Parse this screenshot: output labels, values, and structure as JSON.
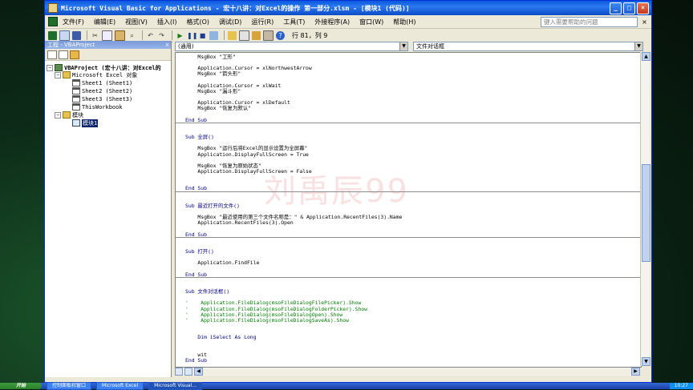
{
  "window": {
    "title": "Microsoft Visual Basic for Applications - 宏十八讲：对Excel的操作 第一部分.xlsm - [模块1 (代码)]"
  },
  "menu": {
    "items": [
      "文件(F)",
      "编辑(E)",
      "视图(V)",
      "插入(I)",
      "格式(O)",
      "调试(D)",
      "运行(R)",
      "工具(T)",
      "外接程序(A)",
      "窗口(W)",
      "帮助(H)"
    ],
    "help_placeholder": "键入需要帮助的问题"
  },
  "toolbar": {
    "row_col": "行 81，列 9"
  },
  "project": {
    "title": "工程 - VBAProject",
    "root": "VBAProject (宏十八讲：对Excel的",
    "excel_objects": "Microsoft Excel 对象",
    "sheets": [
      "Sheet1 (Sheet1)",
      "Sheet2 (Sheet2)",
      "Sheet3 (Sheet3)",
      "ThisWorkbook"
    ],
    "modules_folder": "模块",
    "module1": "模块1"
  },
  "editor": {
    "object_dropdown": "(通用)",
    "proc_dropdown": "文件对话框",
    "watermark": "刘禹辰99",
    "lines": [
      "    MsgBox \"工形\"",
      "",
      "    Application.Cursor = xlNorthwestArrow",
      "    MsgBox \"箭头形\"",
      "",
      "    Application.Cursor = xlWait",
      "    MsgBox \"漏斗形\"",
      "",
      "    Application.Cursor = xlDefault",
      "    MsgBox \"恢复为默认\"",
      "",
      "End Sub",
      "",
      "",
      "Sub 全屏()",
      "",
      "    MsgBox \"运行后将Excel的显示设置为全屏幕\"",
      "    Application.DisplayFullScreen = True",
      "",
      "    MsgBox \"恢复为原始状态\"",
      "    Application.DisplayFullScreen = False",
      "",
      "",
      "End Sub",
      "",
      "",
      "Sub 最近打开的文件()",
      "",
      "    MsgBox \"最近使用的第三个文件名称是：\" & Application.RecentFiles(3).Name",
      "    Application.RecentFiles(3).Open",
      "",
      "End Sub",
      "",
      "",
      "Sub 打开()",
      "",
      "    Application.FindFile",
      "",
      "End Sub",
      "",
      "",
      "Sub 文件对话框()",
      "",
      "'    Application.FileDialog(msoFileDialogFilePicker).Show",
      "'    Application.FileDialog(msoFileDialogFolderPicker).Show",
      "'    Application.FileDialog(msoFileDialogOpen).Show",
      "'    Application.FileDialog(msoFileDialogSaveAs).Show",
      "",
      "",
      "    Dim iSelect As Long",
      "",
      "",
      "    wit",
      "End Sub"
    ]
  },
  "taskbar": {
    "start": "开始",
    "items": [
      "控制面板和窗口",
      "Microsoft Excel",
      "Microsoft Visual..."
    ],
    "clock": "10:27"
  }
}
